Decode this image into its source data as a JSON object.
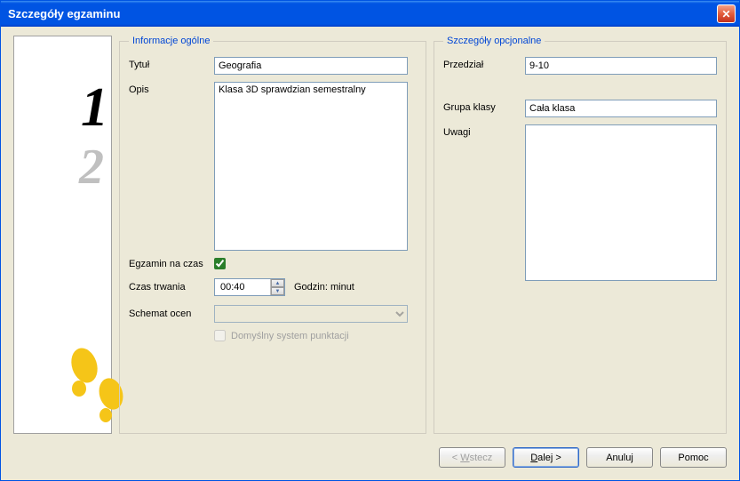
{
  "window": {
    "title": "Szczegóły egzaminu"
  },
  "groups": {
    "general": "Informacje ogólne",
    "optional": "Szczegóły opcjonalne"
  },
  "labels": {
    "title": "Tytuł",
    "description": "Opis",
    "timed": "Egzamin na czas",
    "duration": "Czas trwania",
    "duration_suffix": "Godzin: minut",
    "scheme": "Schemat ocen",
    "default_scoring": "Domyślny system punktacji",
    "age": "Przedział",
    "classgroup": "Grupa klasy",
    "notes": "Uwagi"
  },
  "values": {
    "title": "Geografia",
    "description": "Klasa 3D sprawdzian semestralny",
    "timed": true,
    "duration": "00:40",
    "scheme": "",
    "default_scoring": false,
    "age": "9-10",
    "classgroup": "Cała klasa",
    "notes": ""
  },
  "buttons": {
    "back_prefix": "< ",
    "back_u": "W",
    "back_rest": "stecz",
    "next_u": "D",
    "next_rest": "alej >",
    "cancel": "Anuluj",
    "help": "Pomoc"
  }
}
